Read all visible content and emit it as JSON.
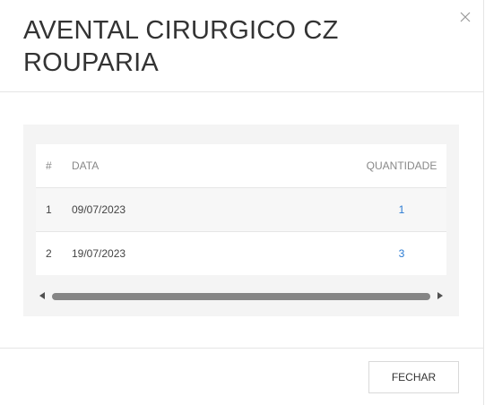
{
  "modal": {
    "title": "AVENTAL CIRURGICO CZ ROUPARIA",
    "close_icon": "close-icon"
  },
  "table": {
    "headers": {
      "num": "#",
      "date": "DATA",
      "qty": "QUANTIDADE"
    },
    "rows": [
      {
        "num": "1",
        "date": "09/07/2023",
        "qty": "1"
      },
      {
        "num": "2",
        "date": "19/07/2023",
        "qty": "3"
      }
    ]
  },
  "scrollbar": {
    "left_icon": "scroll-left-arrow-icon",
    "right_icon": "scroll-right-arrow-icon"
  },
  "footer": {
    "close_label": "FECHAR"
  },
  "colors": {
    "link": "#2b7bd3",
    "panel_bg": "#f4f4f4",
    "border": "#e5e5e5"
  }
}
